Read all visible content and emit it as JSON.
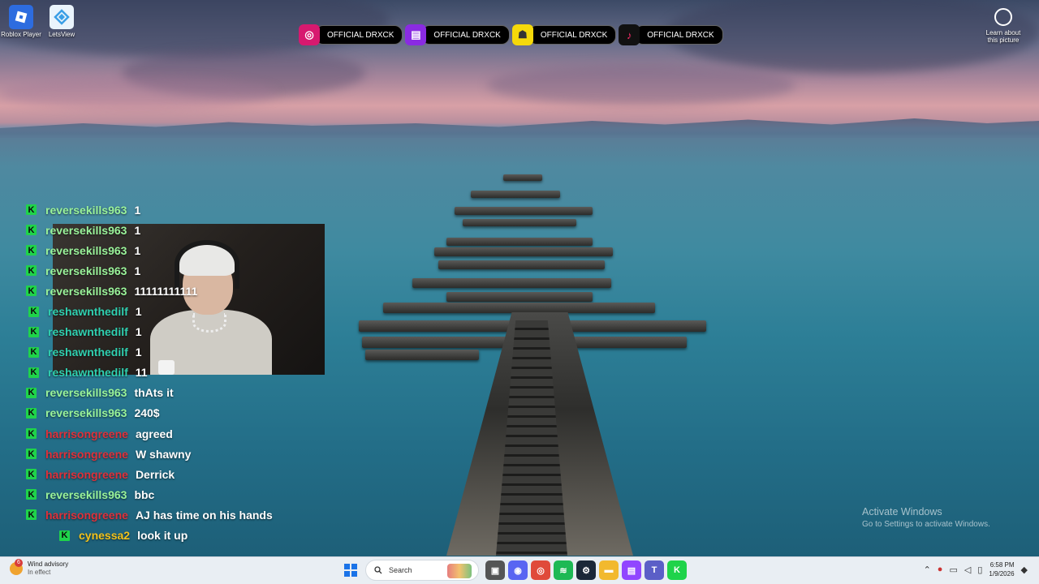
{
  "desktop_icons": [
    {
      "label": "Roblox Player",
      "color": "#2d6cdf"
    },
    {
      "label": "LetsView",
      "color": "#3b9fe6"
    }
  ],
  "learn_about": {
    "line1": "Learn about",
    "line2": "this picture"
  },
  "social_bar": [
    {
      "platform": "instagram-icon",
      "label": "OFFICIAL DRXCK",
      "color": "#d7196f"
    },
    {
      "platform": "twitch-icon",
      "label": "OFFICIAL DRXCK",
      "color": "#8a2be2"
    },
    {
      "platform": "snapchat-icon",
      "label": "OFFICIAL DRXCK",
      "color": "#f5d90a"
    },
    {
      "platform": "tiktok-icon",
      "label": "OFFICIAL DRXCK",
      "color": "#111111"
    }
  ],
  "chat": {
    "badge": "K",
    "badge_color": "#1fd34a",
    "messages": [
      {
        "user": "reversekills963",
        "text": "1",
        "user_color": "#9af39a"
      },
      {
        "user": "reversekills963",
        "text": "1",
        "user_color": "#9af39a"
      },
      {
        "user": "reversekills963",
        "text": "1",
        "user_color": "#9af39a"
      },
      {
        "user": "reversekills963",
        "text": "1",
        "user_color": "#9af39a"
      },
      {
        "user": "reversekills963",
        "text": "11111111111",
        "user_color": "#9af39a"
      },
      {
        "user": "reshawnthedilf",
        "text": "1",
        "user_color": "#2fd0b0"
      },
      {
        "user": "reshawnthedilf",
        "text": "1",
        "user_color": "#2fd0b0"
      },
      {
        "user": "reshawnthedilf",
        "text": "1",
        "user_color": "#2fd0b0"
      },
      {
        "user": "reshawnthedilf",
        "text": "11",
        "user_color": "#2fd0b0"
      },
      {
        "user": "reversekills963",
        "text": "thAts it",
        "user_color": "#9af39a"
      },
      {
        "user": "reversekills963",
        "text": "240$",
        "user_color": "#9af39a"
      },
      {
        "user": "harrisongreene",
        "text": "agreed",
        "user_color": "#e0303a"
      },
      {
        "user": "harrisongreene",
        "text": "W shawny",
        "user_color": "#e0303a"
      },
      {
        "user": "harrisongreene",
        "text": "Derrick",
        "user_color": "#e0303a"
      },
      {
        "user": "reversekills963",
        "text": "bbc",
        "user_color": "#9af39a"
      },
      {
        "user": "harrisongreene",
        "text": "AJ has time on his hands",
        "user_color": "#e0303a"
      },
      {
        "user": "cynessa2",
        "text": "look it up",
        "user_color": "#f3c21b"
      }
    ]
  },
  "activate_windows": {
    "title": "Activate Windows",
    "subtitle": "Go to Settings to activate Windows."
  },
  "taskbar": {
    "weather": {
      "title": "Wind advisory",
      "subtitle": "In effect",
      "badge": "6"
    },
    "search_placeholder": "Search",
    "apps": [
      {
        "name": "file-explorer-icon",
        "color": "#555555",
        "glyph": "▣"
      },
      {
        "name": "discord-icon",
        "color": "#5865f2",
        "glyph": "◉"
      },
      {
        "name": "chrome-icon",
        "color": "#e04a3a",
        "glyph": "◎"
      },
      {
        "name": "spotify-icon",
        "color": "#1db954",
        "glyph": "≋"
      },
      {
        "name": "steam-icon",
        "color": "#1b2838",
        "glyph": "⚙"
      },
      {
        "name": "folder-icon",
        "color": "#f2b92e",
        "glyph": "▬"
      },
      {
        "name": "twitch-icon",
        "color": "#9146ff",
        "glyph": "▤"
      },
      {
        "name": "teams-icon",
        "color": "#5b5fc7",
        "glyph": "T"
      },
      {
        "name": "kick-icon",
        "color": "#1fd34a",
        "glyph": "K"
      }
    ],
    "time": "6:58 PM",
    "date": "1/9/2026"
  }
}
